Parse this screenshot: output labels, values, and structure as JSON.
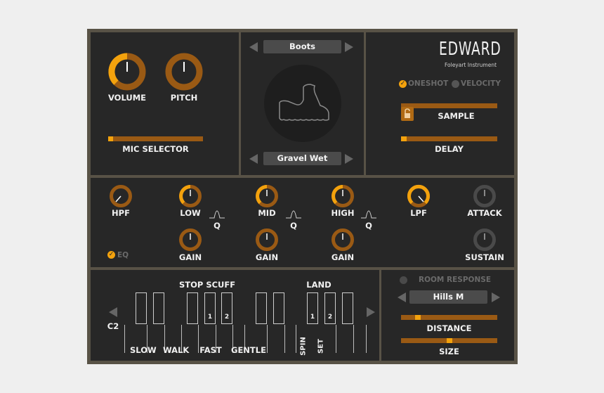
{
  "logo": {
    "name": "EDWARD",
    "subtitle": "Foleyart Instrument"
  },
  "top_left": {
    "volume_label": "VOLUME",
    "pitch_label": "PITCH",
    "mic_selector_label": "MIC SELECTOR",
    "mic_selector_level": 0.05
  },
  "center": {
    "material": "Boots",
    "surface": "Gravel Wet"
  },
  "top_right": {
    "oneshot_label": "ONESHOT",
    "velocity_label": "VELOCITY",
    "sample_label": "SAMPLE",
    "delay_label": "DELAY"
  },
  "eq": {
    "hpf": "HPF",
    "low": "LOW",
    "mid": "MID",
    "high": "HIGH",
    "lpf": "LPF",
    "attack": "ATTACK",
    "sustain": "SUSTAIN",
    "q": "Q",
    "gain": "GAIN",
    "eq_toggle": "EQ"
  },
  "keyboard": {
    "stop_scuff": "STOP SCUFF",
    "land": "LAND",
    "octave": "C2",
    "slow": "SLOW",
    "walk": "WALK",
    "fast": "FAST",
    "gentle": "GENTLE",
    "spin": "SPIN",
    "set": "SET",
    "k1": "1",
    "k2": "2"
  },
  "room": {
    "room_response_label": "ROOM RESPONSE",
    "preset": "Hills M",
    "distance_label": "DISTANCE",
    "size_label": "SIZE"
  },
  "colors": {
    "accent": "#f3a20d",
    "accent_dark": "#9a5a14",
    "panel": "#272727",
    "frame": "#585246"
  }
}
